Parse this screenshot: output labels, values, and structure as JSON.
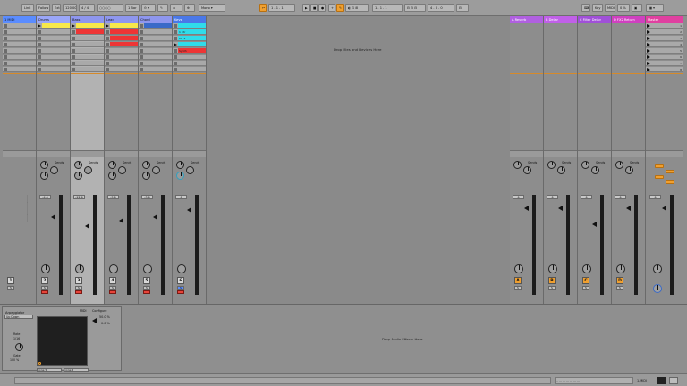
{
  "topbar": {
    "link": "Link",
    "follow": "Follow",
    "bpm": "120.00",
    "time_sig": "4 / 4",
    "quantize": "1 Bar",
    "position": "1 . 1 . 1",
    "length": "4 . 0 . 0",
    "key": "MIDI",
    "cpu": "0 %"
  },
  "colors": {
    "master": "#e040a0",
    "track_blue": "#5a8cff",
    "yellow": "#f7e84a",
    "red": "#ee3535",
    "cyan": "#30dcea",
    "orange": "#f0a030",
    "purple": "#b060e0"
  },
  "tracks": [
    {
      "name": "1 MIDI",
      "num": "1",
      "vol": "-inf",
      "color": "#5a8cff"
    },
    {
      "name": "Drums",
      "num": "2",
      "vol": "-4.0",
      "color": "#9aa6f8"
    },
    {
      "name": "Bass",
      "num": "3",
      "vol": "-12.0",
      "color": "#8e96ee"
    },
    {
      "name": "Lead",
      "num": "4",
      "vol": "-5.0",
      "color": "#8e96ee"
    },
    {
      "name": "Chord",
      "num": "5",
      "vol": "-3.0",
      "color": "#8e96ee"
    },
    {
      "name": "Keys",
      "num": "6",
      "vol": "0",
      "color": "#4a78e8"
    }
  ],
  "clips": {
    "drums": [
      "",
      ""
    ],
    "cyan_names": [
      "1 Ctr",
      "Ctr 2",
      "",
      ""
    ],
    "red_name": "Synth"
  },
  "returns": [
    {
      "name": "A Reverb",
      "num": "A",
      "vol": "0"
    },
    {
      "name": "B Delay",
      "num": "B",
      "vol": "0"
    },
    {
      "name": "C Filter Delay",
      "num": "C",
      "vol": "0"
    },
    {
      "name": "D FX2 Return",
      "num": "D",
      "vol": "0"
    }
  ],
  "master": {
    "name": "Master",
    "vol": "0",
    "scenes": [
      "1",
      "2",
      "3",
      "4",
      "5",
      "6",
      "7",
      "8"
    ]
  },
  "session": {
    "drop_text": "Drop Files and Devices Here",
    "sends_label": "Sends"
  },
  "device": {
    "name": "Arpeggiator",
    "mode": "Up Down",
    "param_rate": "Rate",
    "param_rate_val": "1/16",
    "param_gate": "Gate",
    "param_gate_val": "50.0 %",
    "hz_label": "100 %",
    "drop_text": "Drop Audio Effects Here",
    "midi_label": "MIDI",
    "config": "Configure",
    "config_val": "0.0 %"
  },
  "status": {
    "track": "1-MIDI"
  }
}
